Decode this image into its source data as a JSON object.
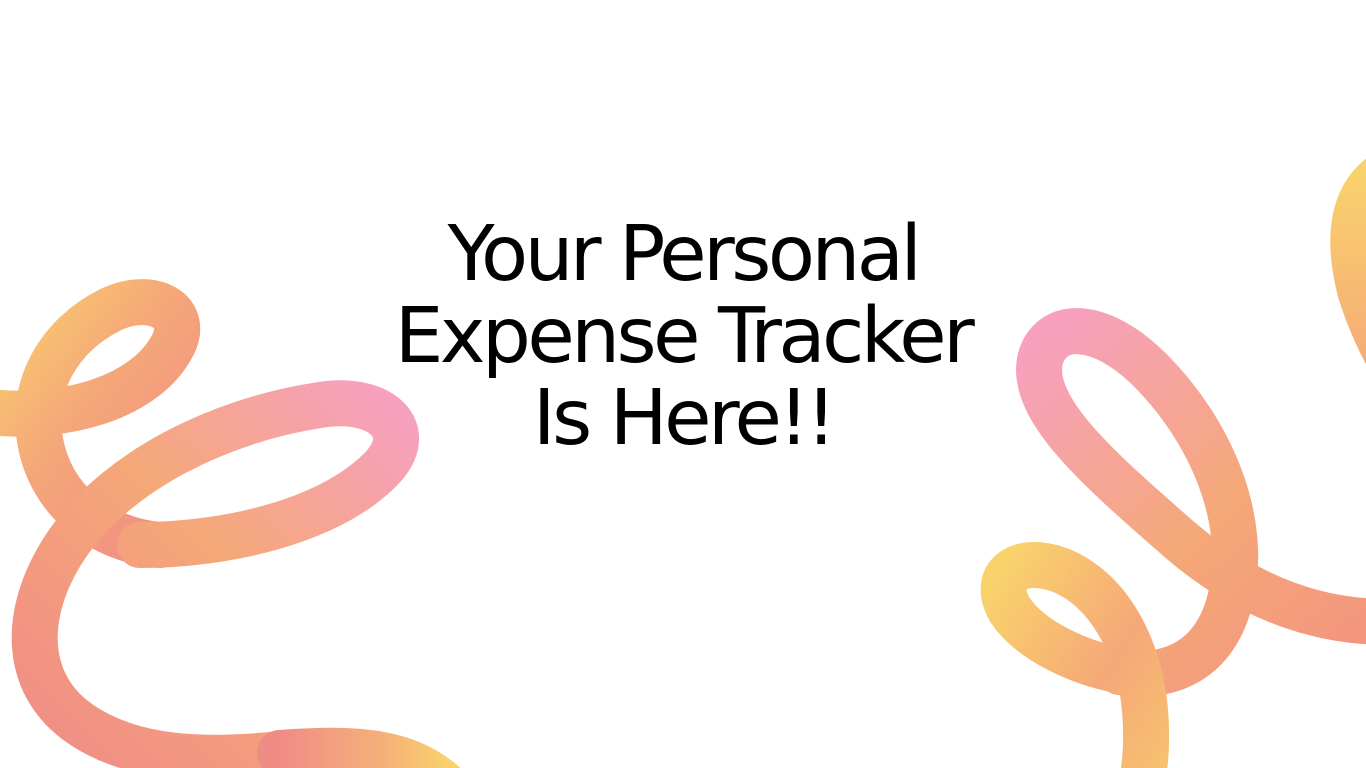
{
  "slide": {
    "headline_lines": [
      "Your Personal",
      "Expense Tracker",
      "Is Here!!"
    ]
  },
  "decoration": {
    "name": "gradient-ribbons",
    "colors": {
      "yellow": "#f9d26c",
      "peach": "#f5a878",
      "coral": "#f08c86",
      "pink": "#f7a0c0"
    }
  }
}
